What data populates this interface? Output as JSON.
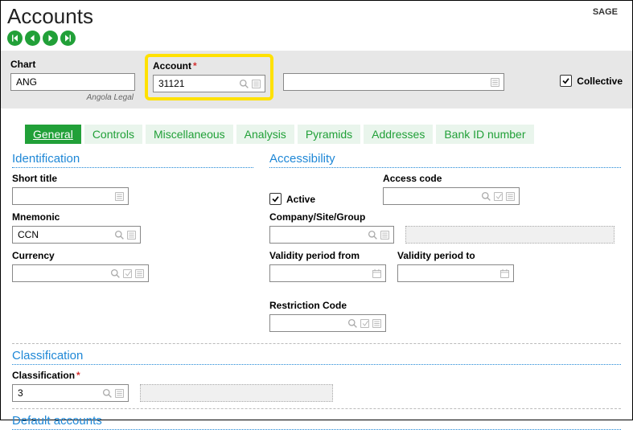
{
  "brand": "SAGE",
  "page_title": "Accounts",
  "criteria": {
    "chart_label": "Chart",
    "chart_value": "ANG",
    "chart_hint": "Angola Legal",
    "account_label": "Account",
    "account_value": "31121",
    "desc_value": "",
    "collective_label": "Collective",
    "collective_checked": true
  },
  "tabs": [
    "General",
    "Controls",
    "Miscellaneous",
    "Analysis",
    "Pyramids",
    "Addresses",
    "Bank ID number"
  ],
  "active_tab": 0,
  "sections": {
    "identification": {
      "title": "Identification",
      "short_title_label": "Short title",
      "short_title_value": "",
      "mnemonic_label": "Mnemonic",
      "mnemonic_value": "CCN",
      "currency_label": "Currency",
      "currency_value": ""
    },
    "accessibility": {
      "title": "Accessibility",
      "active_label": "Active",
      "active_checked": true,
      "access_code_label": "Access code",
      "access_code_value": "",
      "company_label": "Company/Site/Group",
      "company_value": "",
      "validity_from_label": "Validity period from",
      "validity_from_value": "",
      "validity_to_label": "Validity period to",
      "validity_to_value": "",
      "restriction_label": "Restriction Code",
      "restriction_value": ""
    },
    "classification": {
      "title": "Classification",
      "classification_label": "Classification",
      "classification_value": "3"
    },
    "default_accounts": {
      "title": "Default accounts"
    }
  }
}
